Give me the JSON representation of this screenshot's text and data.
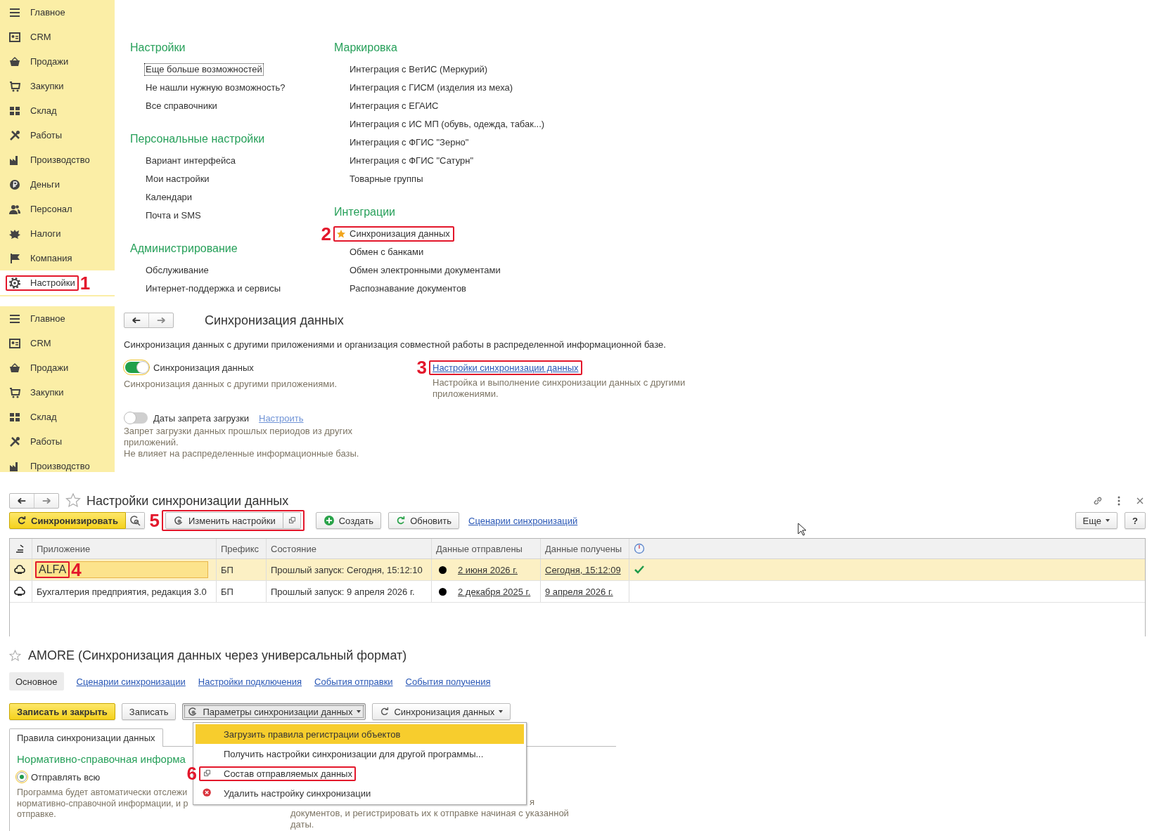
{
  "main_menu": {
    "sidebar": {
      "items": [
        {
          "label": "Главное",
          "selected": false
        },
        {
          "label": "CRM",
          "selected": false
        },
        {
          "label": "Продажи",
          "selected": false
        },
        {
          "label": "Закупки",
          "selected": false
        },
        {
          "label": "Склад",
          "selected": false
        },
        {
          "label": "Работы",
          "selected": false
        },
        {
          "label": "Производство",
          "selected": false
        },
        {
          "label": "Деньги",
          "selected": false
        },
        {
          "label": "Персонал",
          "selected": false
        },
        {
          "label": "Налоги",
          "selected": false
        },
        {
          "label": "Компания",
          "selected": false
        },
        {
          "label": "Настройки",
          "selected": true,
          "callout": "1"
        }
      ]
    },
    "columns": [
      {
        "sections": [
          {
            "heading": "Настройки",
            "items": [
              {
                "label": "Еще больше возможностей",
                "focused": true,
                "starred": false
              },
              {
                "label": "Не нашли нужную возможность?",
                "focused": false,
                "starred": false
              },
              {
                "label": "Все справочники",
                "focused": false,
                "starred": false
              }
            ]
          },
          {
            "heading": "Персональные настройки",
            "items": [
              {
                "label": "Вариант интерфейса",
                "focused": false,
                "starred": false
              },
              {
                "label": "Мои настройки",
                "focused": false,
                "starred": false
              },
              {
                "label": "Календари",
                "focused": false,
                "starred": false
              },
              {
                "label": "Почта и SMS",
                "focused": false,
                "starred": false
              }
            ]
          },
          {
            "heading": "Администрирование",
            "items": [
              {
                "label": "Обслуживание",
                "focused": false,
                "starred": false
              },
              {
                "label": "Интернет-поддержка и сервисы",
                "focused": false,
                "starred": false
              }
            ]
          }
        ]
      },
      {
        "sections": [
          {
            "heading": "Маркировка",
            "items": [
              {
                "label": "Интеграция с ВетИС (Меркурий)",
                "focused": false,
                "starred": false
              },
              {
                "label": "Интеграция с ГИСМ (изделия из меха)",
                "focused": false,
                "starred": false
              },
              {
                "label": "Интеграция с ЕГАИС",
                "focused": false,
                "starred": false
              },
              {
                "label": "Интеграция с ИС МП (обувь, одежда, табак...)",
                "focused": false,
                "starred": false
              },
              {
                "label": "Интеграция с ФГИС \"Зерно\"",
                "focused": false,
                "starred": false
              },
              {
                "label": "Интеграция с ФГИС \"Сатурн\"",
                "focused": false,
                "starred": false
              },
              {
                "label": "Товарные группы",
                "focused": false,
                "starred": false
              }
            ]
          },
          {
            "heading": "Интеграции",
            "items": [
              {
                "label": "Синхронизация данных",
                "focused": false,
                "starred": true,
                "callout": "2"
              },
              {
                "label": "Обмен с банками",
                "focused": false,
                "starred": false
              },
              {
                "label": "Обмен электронными документами",
                "focused": false,
                "starred": false
              },
              {
                "label": "Распознавание документов",
                "focused": false,
                "starred": false
              }
            ]
          }
        ]
      }
    ]
  },
  "sync_panel": {
    "sidebar_items": [
      "Главное",
      "CRM",
      "Продажи",
      "Закупки",
      "Склад",
      "Работы",
      "Производство"
    ],
    "title": "Синхронизация данных",
    "description": "Синхронизация данных с другими приложениями и организация совместной работы в распределенной информационной базе.",
    "options": [
      {
        "label": "Синхронизация данных",
        "on": true,
        "focused": true,
        "hints": [
          "Синхронизация данных с другими приложениями."
        ]
      },
      {
        "label": "Даты запрета загрузки",
        "on": false,
        "focused": false,
        "link": "Настроить",
        "hints": [
          "Запрет загрузки данных прошлых периодов из других приложений.",
          "Не влияет на распределенные информационные базы."
        ]
      }
    ],
    "settings_link": {
      "label": "Настройки синхронизации данных",
      "callout": "3",
      "hint": "Настройка и выполнение синхронизации данных с другими приложениями."
    }
  },
  "sync_settings_form": {
    "title": "Настройки синхронизации данных",
    "toolbar": {
      "sync_button": "Синхронизировать",
      "edit_button": {
        "label": "Изменить настройки",
        "callout": "5"
      },
      "create_button": "Создать",
      "refresh_button": "Обновить",
      "scenarios_link": "Сценарии синхронизаций",
      "more_button": "Еще",
      "help_button": "?"
    },
    "table": {
      "columns": [
        "Приложение",
        "Префикс",
        "Состояние",
        "Данные отправлены",
        "Данные получены"
      ],
      "rows": [
        {
          "application": "ALFA",
          "prefix": "БП",
          "state": "Прошлый запуск: Сегодня, 15:12:10",
          "sent": "2 июня 2026 г.",
          "received": "Сегодня, 15:12:09",
          "success": true,
          "selected": true,
          "callout": "4"
        },
        {
          "application": "Бухгалтерия предприятия, редакция 3.0",
          "prefix": "БП",
          "state": "Прошлый запуск: 9 апреля 2026 г.",
          "sent": "2 декабря 2025 г.",
          "received": "9 апреля 2026 г.",
          "success": false,
          "selected": false
        }
      ]
    }
  },
  "exchange_form": {
    "title": "AMORE (Синхронизация данных через универсальный формат)",
    "tabs": [
      {
        "label": "Основное",
        "selected": true
      },
      {
        "label": "Сценарии синхронизации",
        "selected": false
      },
      {
        "label": "Настройки подключения",
        "selected": false
      },
      {
        "label": "События отправки",
        "selected": false
      },
      {
        "label": "События получения",
        "selected": false
      }
    ],
    "buttons": {
      "save_close": "Записать и закрыть",
      "save": "Записать",
      "params": "Параметры синхронизации данных",
      "sync": "Синхронизация данных"
    },
    "menu": {
      "items": [
        {
          "label": "Загрузить правила регистрации объектов",
          "selected": true
        },
        {
          "label": "Получить настройки синхронизации для другой программы...",
          "selected": false
        },
        {
          "label": "Состав отправляемых данных",
          "selected": false,
          "callout": "6"
        },
        {
          "label": "Удалить настройку синхронизации",
          "selected": false
        }
      ]
    },
    "page_tab": "Правила синхронизации данных",
    "section_heading": "Нормативно-справочная информа",
    "radio": {
      "label": "Отправлять всю",
      "checked": true
    },
    "hint_lines": [
      "Программа будет автоматически отслежи",
      "нормативно-справочной информации, и р",
      "отправке."
    ],
    "right_hint_lines": [
      "я",
      "документов, и регистрировать их к отправке начиная с указанной",
      "даты."
    ]
  }
}
